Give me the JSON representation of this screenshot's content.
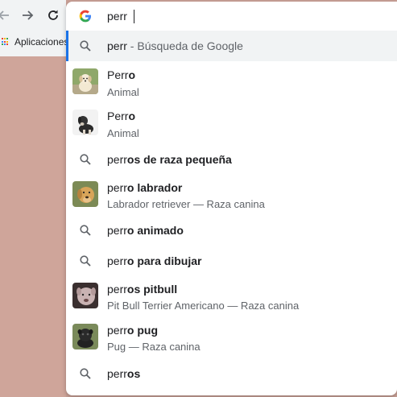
{
  "browser": {
    "bookmarks_label": "Aplicaciones",
    "back_icon": "back-arrow-icon",
    "forward_icon": "forward-arrow-icon",
    "reload_icon": "reload-icon"
  },
  "omnibox": {
    "query": "perr",
    "logo": "google-g-icon",
    "suggestions": [
      {
        "kind": "search",
        "plain": "perr",
        "bold": "",
        "sub_sep": " - ",
        "sub": "Búsqueda de Google",
        "selected": true
      },
      {
        "kind": "entity",
        "plain": "Perr",
        "bold": "o",
        "sub": "Animal",
        "thumb": "light-dog-puppy"
      },
      {
        "kind": "entity",
        "plain": "Perr",
        "bold": "o",
        "sub": "Animal",
        "thumb": "dark-dog-puppy"
      },
      {
        "kind": "search",
        "plain": "perr",
        "bold": "os de raza pequeña"
      },
      {
        "kind": "entity",
        "plain": "perr",
        "bold": "o labrador",
        "sub": "Labrador retriever — Raza canina",
        "thumb": "labrador"
      },
      {
        "kind": "search",
        "plain": "perr",
        "bold": "o animado"
      },
      {
        "kind": "search",
        "plain": "perr",
        "bold": "o para dibujar"
      },
      {
        "kind": "entity",
        "plain": "perr",
        "bold": "os pitbull",
        "sub": "Pit Bull Terrier Americano — Raza canina",
        "thumb": "pitbull"
      },
      {
        "kind": "entity",
        "plain": "perr",
        "bold": "o pug",
        "sub": "Pug — Raza canina",
        "thumb": "pug"
      },
      {
        "kind": "search",
        "plain": "perr",
        "bold": "os"
      }
    ]
  },
  "colors": {
    "accent": "#1a73e8",
    "page_background": "#c9a096"
  }
}
